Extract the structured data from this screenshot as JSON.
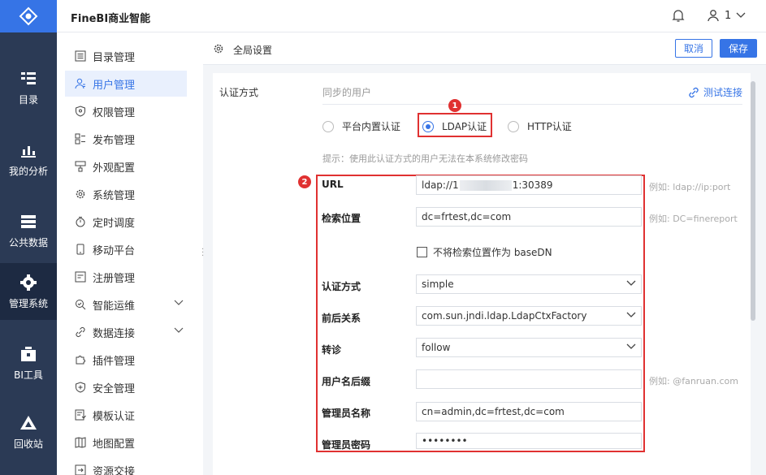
{
  "rail": {
    "items": [
      {
        "label": "目录",
        "icon": "catalog-icon"
      },
      {
        "label": "我的分析",
        "icon": "analysis-icon"
      },
      {
        "label": "公共数据",
        "icon": "data-icon"
      },
      {
        "label": "管理系统",
        "icon": "gear-icon",
        "active": true
      },
      {
        "label": "BI工具",
        "icon": "toolbox-icon"
      },
      {
        "label": "回收站",
        "icon": "recycle-icon"
      }
    ]
  },
  "header": {
    "title": "FineBI商业智能",
    "user": "1"
  },
  "menu": {
    "items": [
      {
        "label": "目录管理"
      },
      {
        "label": "用户管理",
        "active": true
      },
      {
        "label": "权限管理"
      },
      {
        "label": "发布管理"
      },
      {
        "label": "外观配置"
      },
      {
        "label": "系统管理"
      },
      {
        "label": "定时调度"
      },
      {
        "label": "移动平台"
      },
      {
        "label": "注册管理"
      },
      {
        "label": "智能运维",
        "expandable": true
      },
      {
        "label": "数据连接",
        "expandable": true
      },
      {
        "label": "插件管理"
      },
      {
        "label": "安全管理"
      },
      {
        "label": "模板认证"
      },
      {
        "label": "地图配置"
      },
      {
        "label": "资源交接"
      }
    ]
  },
  "toolbar": {
    "title": "全局设置",
    "cancel": "取消",
    "save": "保存"
  },
  "auth": {
    "section_label": "认证方式",
    "sync_label": "同步的用户",
    "test_link": "测试连接",
    "options": [
      "平台内置认证",
      "LDAP认证",
      "HTTP认证"
    ],
    "selected": "LDAP认证",
    "hint": "提示：使用此认证方式的用户无法在本系统修改密码",
    "badge1": "1",
    "badge2": "2"
  },
  "form": {
    "url": {
      "label": "URL",
      "value_prefix": "ldap://1",
      "value_suffix": "1:30389",
      "example": "例如: ldap://ip:port"
    },
    "search_base": {
      "label": "检索位置",
      "value": "dc=frtest,dc=com",
      "example": "例如: DC=finereport"
    },
    "no_base_dn": {
      "label": "不将检索位置作为 baseDN"
    },
    "auth_type": {
      "label": "认证方式",
      "value": "simple"
    },
    "context": {
      "label": "前后关系",
      "value": "com.sun.jndi.ldap.LdapCtxFactory"
    },
    "referral": {
      "label": "转诊",
      "value": "follow"
    },
    "suffix": {
      "label": "用户名后缀",
      "value": "",
      "example": "例如: @fanruan.com"
    },
    "admin_name": {
      "label": "管理员名称",
      "value": "cn=admin,dc=frtest,dc=com"
    },
    "admin_pwd": {
      "label": "管理员密码",
      "value": "••••••••"
    }
  },
  "colors": {
    "primary": "#3674e6",
    "rail": "#2b3a55",
    "highlight": "#e03131"
  }
}
